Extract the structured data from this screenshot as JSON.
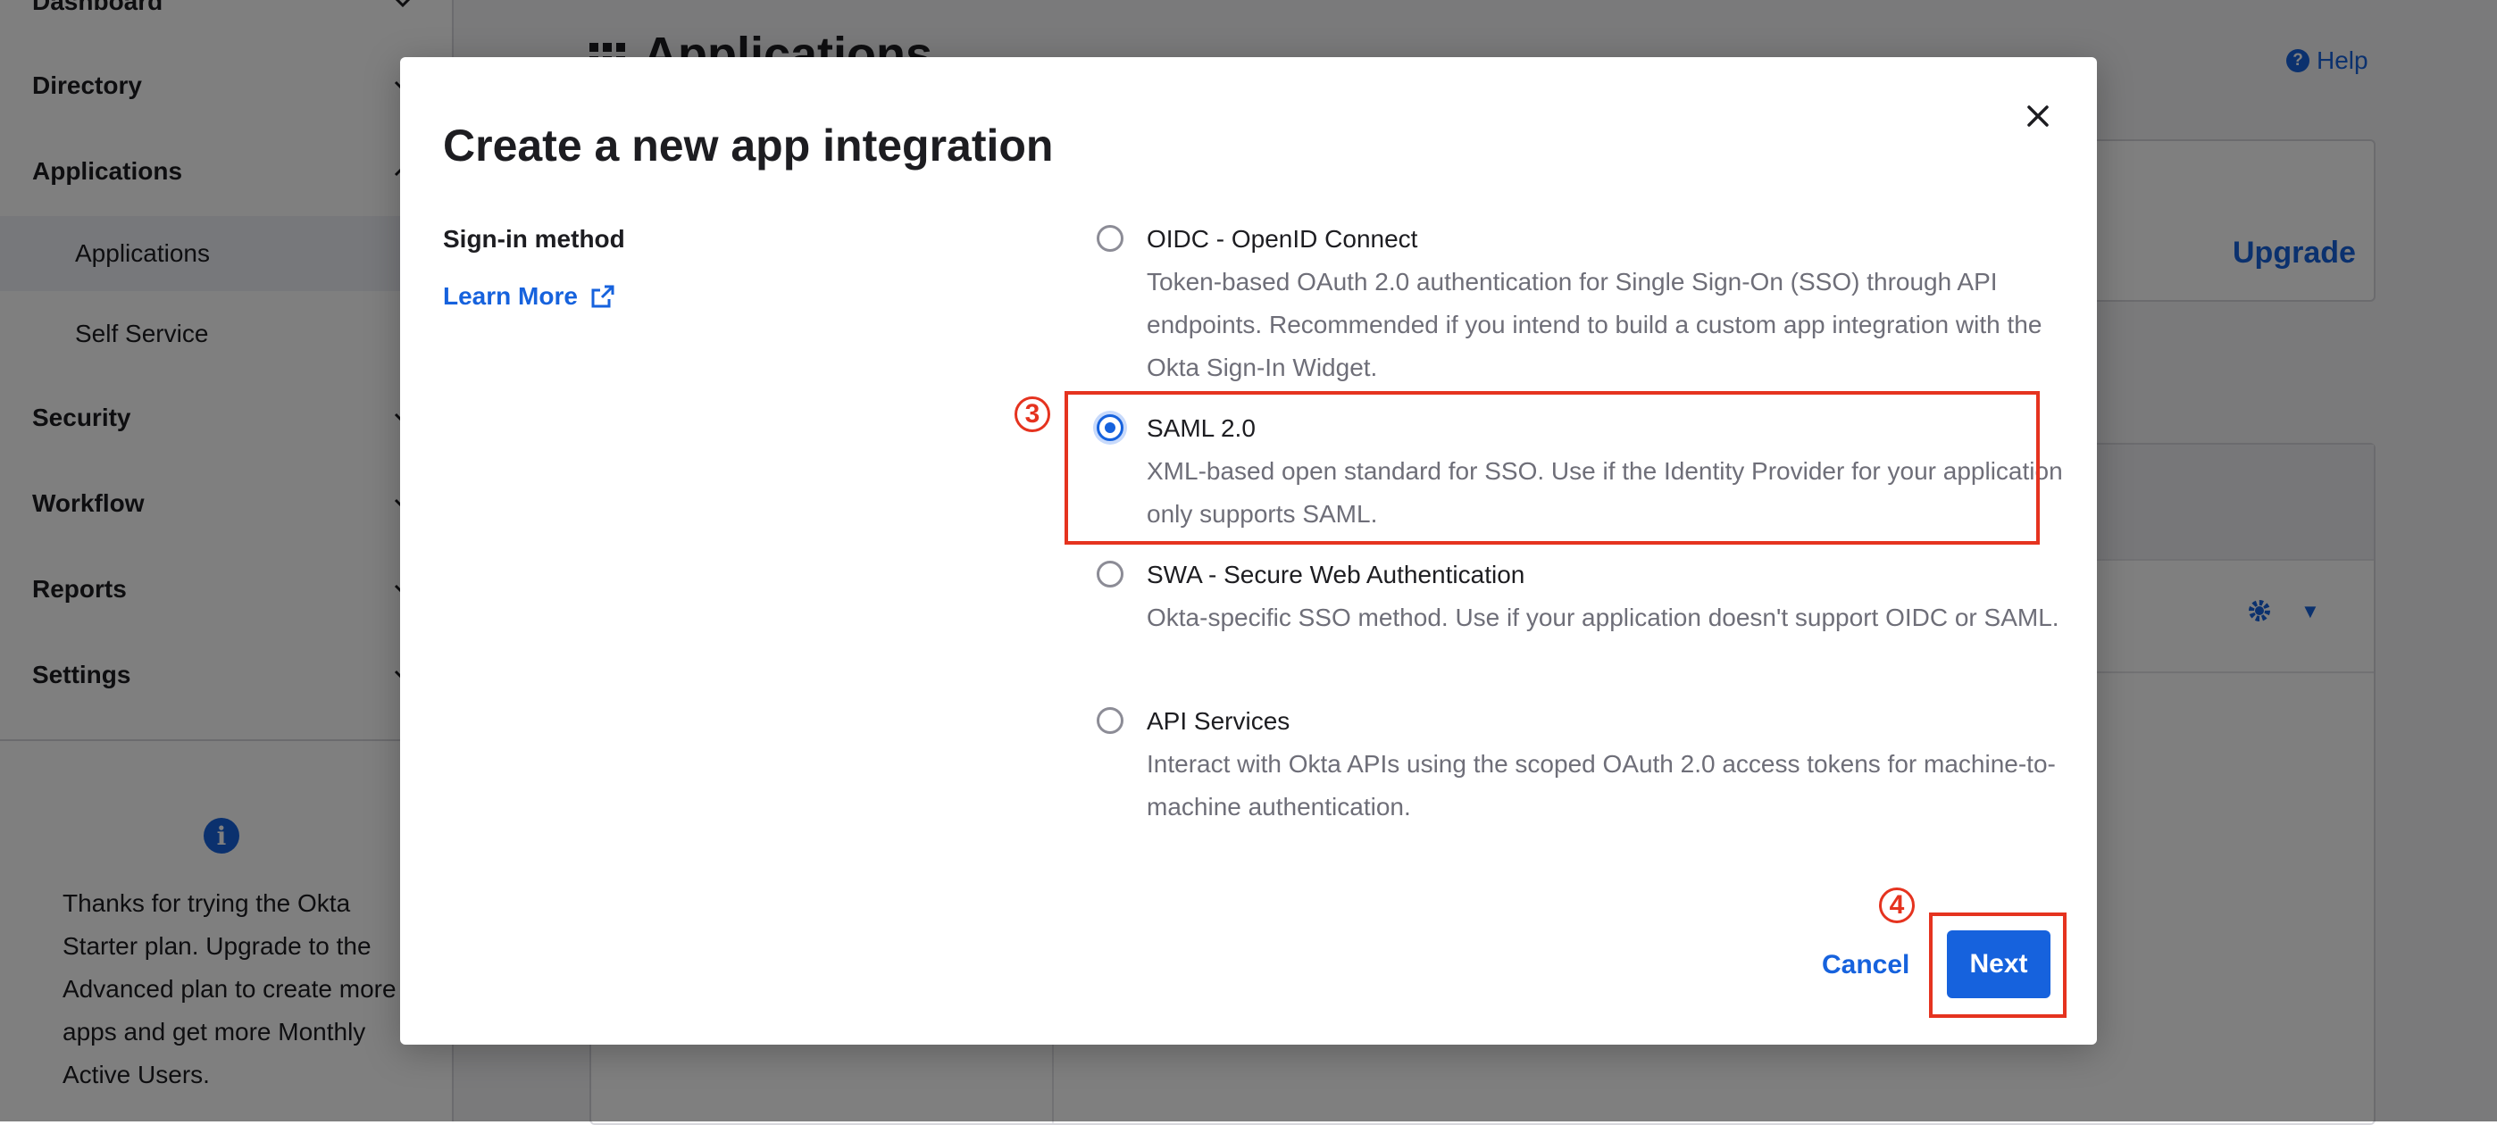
{
  "sidebar": {
    "items": [
      {
        "label": "Dashboard"
      },
      {
        "label": "Directory"
      },
      {
        "label": "Applications"
      },
      {
        "label": "Security"
      },
      {
        "label": "Workflow"
      },
      {
        "label": "Reports"
      },
      {
        "label": "Settings"
      }
    ],
    "sub_items": [
      {
        "label": "Applications",
        "active": true
      },
      {
        "label": "Self Service",
        "active": false
      }
    ],
    "promo_text": "Thanks for trying the Okta Starter plan. Upgrade to the Advanced plan to create more apps and get more Monthly Active Users."
  },
  "main": {
    "title": "Applications",
    "help_label": "Help",
    "upgrade_label": "Upgrade"
  },
  "modal": {
    "title": "Create a new app integration",
    "field_label": "Sign-in method",
    "learn_more": "Learn More",
    "options": [
      {
        "title": "OIDC - OpenID Connect",
        "description": "Token-based OAuth 2.0 authentication for Single Sign-On (SSO) through API endpoints. Recommended if you intend to build a custom app integration with the Okta Sign-In Widget.",
        "selected": false
      },
      {
        "title": "SAML 2.0",
        "description": "XML-based open standard for SSO. Use if the Identity Provider for your application only supports SAML.",
        "selected": true
      },
      {
        "title": "SWA - Secure Web Authentication",
        "description": "Okta-specific SSO method. Use if your application doesn't support OIDC or SAML.",
        "selected": false
      },
      {
        "title": "API Services",
        "description": "Interact with Okta APIs using the scoped OAuth 2.0 access tokens for machine-to-machine authentication.",
        "selected": false
      }
    ],
    "cancel_label": "Cancel",
    "next_label": "Next"
  },
  "annotations": {
    "step3": "3",
    "step4": "4",
    "highlight_color": "#e5331f"
  },
  "colors": {
    "accent": "#1662dd",
    "text": "#1d1d21",
    "muted": "#6e6e78"
  }
}
